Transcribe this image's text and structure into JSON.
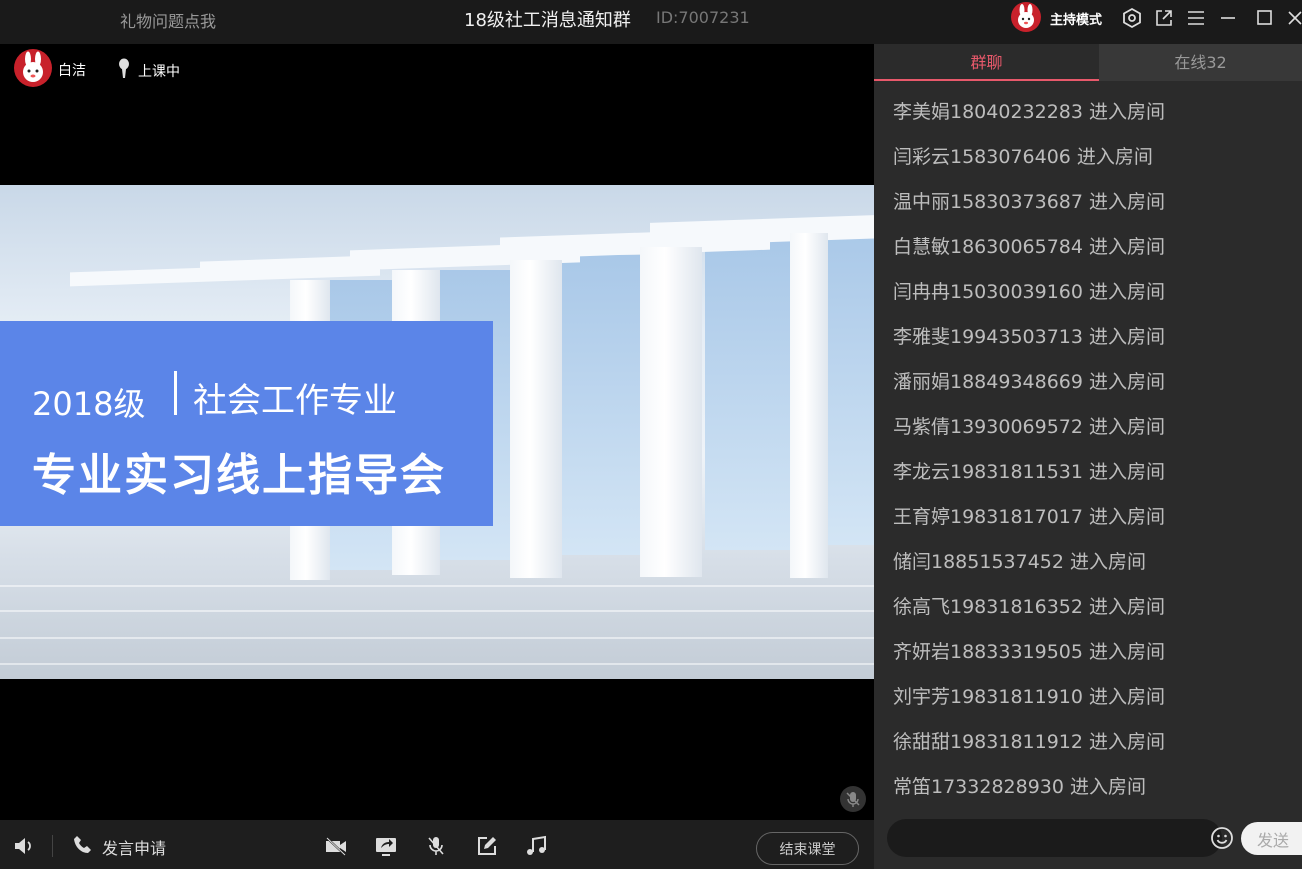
{
  "topbar": {
    "gift_link": "礼物问题点我",
    "room_title": "18级社工消息通知群",
    "room_id": "ID:7007231",
    "host_mode": "主持模式",
    "icons": [
      "settings-icon",
      "external-link-icon",
      "menu-icon",
      "minimize-icon",
      "maximize-icon",
      "close-icon"
    ]
  },
  "stage": {
    "teacher_name": "白洁",
    "class_status": "上课中",
    "slide": {
      "year": "2018级",
      "major": "社会工作专业",
      "subtitle": "专业实习线上指导会"
    }
  },
  "bottombar": {
    "speak_request": "发言申请",
    "end_class": "结束课堂"
  },
  "sidebar": {
    "tabs": [
      {
        "label": "群聊",
        "active": true
      },
      {
        "label": "在线32",
        "active": false
      }
    ],
    "messages": [
      "李美娟18040232283 进入房间",
      "闫彩云1583076406 进入房间",
      "温中丽15830373687 进入房间",
      "白慧敏18630065784 进入房间",
      "闫冉冉15030039160 进入房间",
      "李雅斐19943503713 进入房间",
      "潘丽娟18849348669 进入房间",
      "马紫倩13930069572 进入房间",
      "李龙云19831811531 进入房间",
      "王育婷19831817017 进入房间",
      "储闫18851537452 进入房间",
      "徐高飞19831816352 进入房间",
      "齐妍岩18833319505 进入房间",
      "刘宇芳19831811910 进入房间",
      "徐甜甜19831811912 进入房间",
      "常笛17332828930 进入房间"
    ],
    "send_label": "发送"
  },
  "colors": {
    "accent": "#e8596b",
    "slide_box": "#5b85e8"
  }
}
